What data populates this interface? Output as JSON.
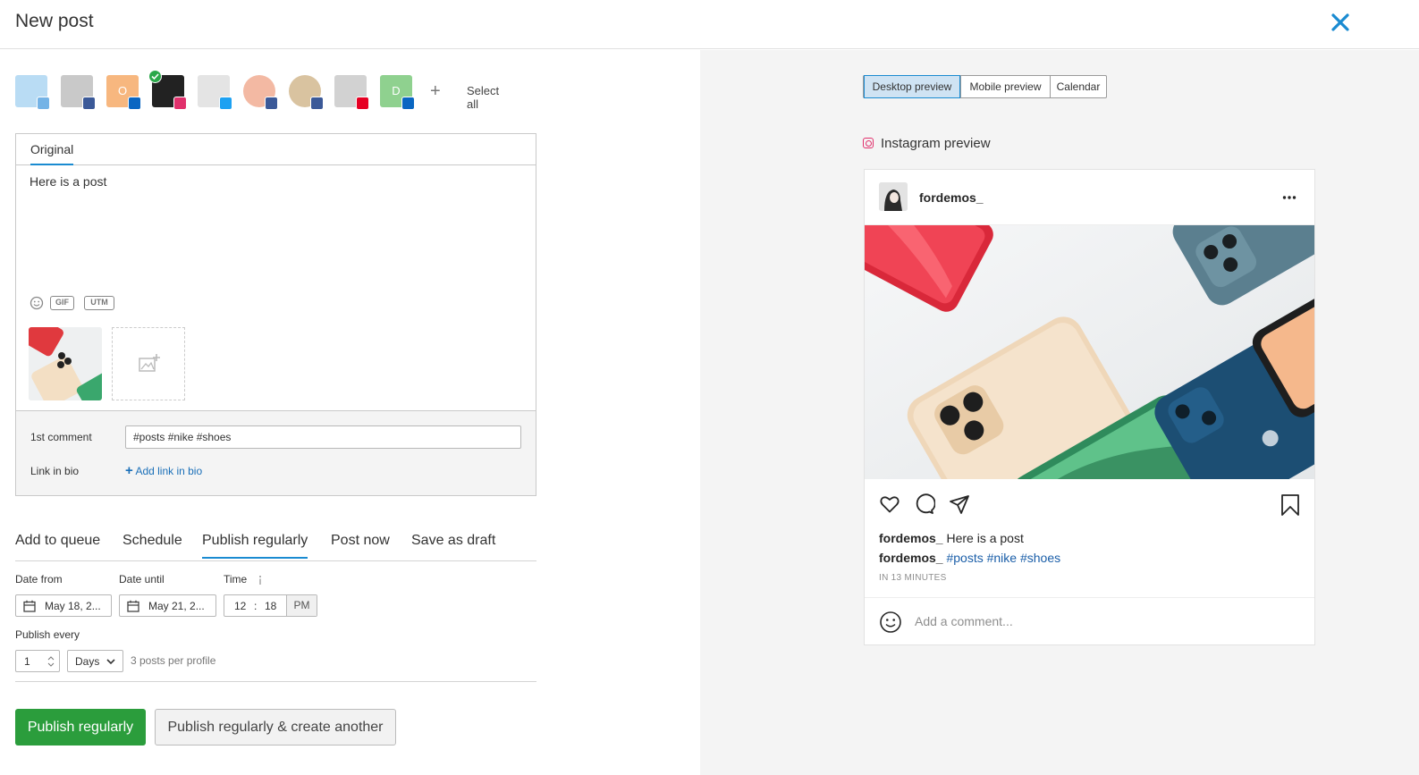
{
  "header": {
    "title": "New post"
  },
  "profiles": {
    "items": [
      {
        "network": "group",
        "letter": "",
        "color": "#b9dcf4",
        "badge_color": "#74b3e6"
      },
      {
        "network": "facebook",
        "letter": "",
        "color": "#c9c9c9",
        "badge_color": "#3b5998"
      },
      {
        "network": "linkedin",
        "letter": "O",
        "color": "#f7b77f",
        "badge_color": "#0a66c2"
      },
      {
        "network": "instagram",
        "letter": "",
        "color": "#222222",
        "badge_color": "#e1306c",
        "selected": true
      },
      {
        "network": "twitter",
        "letter": "",
        "color": "#e4e4e4",
        "badge_color": "#1da1f2"
      },
      {
        "network": "facebook",
        "letter": "",
        "color": "#f3b9a3",
        "badge_color": "#3b5998"
      },
      {
        "network": "facebook",
        "letter": "",
        "color": "#d9c3a0",
        "badge_color": "#3b5998"
      },
      {
        "network": "pinterest",
        "letter": "",
        "color": "#d2d2d2",
        "badge_color": "#e60023"
      },
      {
        "network": "linkedin",
        "letter": "D",
        "color": "#8fd18f",
        "badge_color": "#0a66c2"
      }
    ],
    "select_all": "Select all"
  },
  "editor": {
    "tab": "Original",
    "text": "Here is a post",
    "tools": [
      "GIF",
      "UTM"
    ],
    "first_comment_label": "1st comment",
    "first_comment_value": "#posts #nike #shoes",
    "link_in_bio_label": "Link in bio",
    "add_link_in_bio": "Add link in bio"
  },
  "modes": {
    "items": [
      "Add to queue",
      "Schedule",
      "Publish regularly",
      "Post now",
      "Save as draft"
    ],
    "active": "Publish regularly"
  },
  "schedule": {
    "date_from_label": "Date from",
    "date_from": "May 18, 2...",
    "date_until_label": "Date until",
    "date_until": "May 21, 2...",
    "time_label": "Time",
    "hour": "12",
    "separator": ":",
    "minute": "18",
    "ampm": "PM",
    "publish_every_label": "Publish every",
    "every_value": "1",
    "every_unit": "Days",
    "hint": "3 posts per profile"
  },
  "buttons": {
    "primary": "Publish regularly",
    "secondary": "Publish regularly & create another"
  },
  "preview": {
    "tabs": [
      "Desktop preview",
      "Mobile preview",
      "Calendar"
    ],
    "active_tab": "Desktop preview",
    "title": "Instagram preview",
    "username": "fordemos_",
    "caption_user": "fordemos_",
    "caption_text": "Here is a post",
    "comment_user": "fordemos_",
    "comment_tags": "#posts #nike #shoes",
    "time": "IN 13 MINUTES",
    "add_comment": "Add a comment..."
  },
  "colors": {
    "accent": "#1a8bd1",
    "primary_button": "#2b9d3c",
    "instagram": "#e1306c"
  }
}
